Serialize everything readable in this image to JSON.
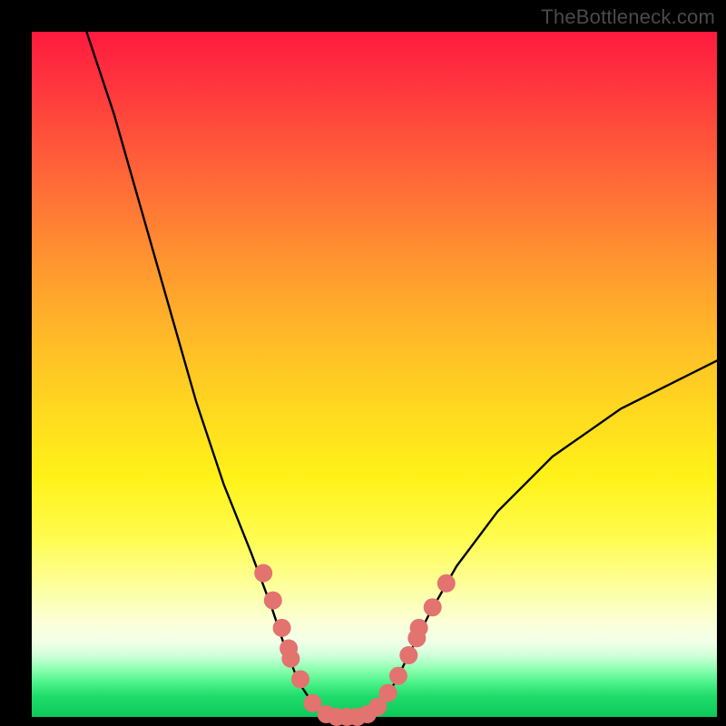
{
  "attribution": "TheBottleneck.com",
  "chart_data": {
    "type": "line",
    "title": "",
    "xlabel": "",
    "ylabel": "",
    "xlim": [
      0,
      100
    ],
    "ylim": [
      0,
      100
    ],
    "curve": [
      {
        "x": 8,
        "y": 100
      },
      {
        "x": 12,
        "y": 88
      },
      {
        "x": 16,
        "y": 74
      },
      {
        "x": 20,
        "y": 60
      },
      {
        "x": 24,
        "y": 46
      },
      {
        "x": 28,
        "y": 34
      },
      {
        "x": 32,
        "y": 24
      },
      {
        "x": 35,
        "y": 16
      },
      {
        "x": 37,
        "y": 10
      },
      {
        "x": 39,
        "y": 5
      },
      {
        "x": 41,
        "y": 2
      },
      {
        "x": 43,
        "y": 0.4
      },
      {
        "x": 45,
        "y": 0
      },
      {
        "x": 47,
        "y": 0
      },
      {
        "x": 49,
        "y": 0.4
      },
      {
        "x": 51,
        "y": 2
      },
      {
        "x": 53,
        "y": 5
      },
      {
        "x": 55,
        "y": 9
      },
      {
        "x": 58,
        "y": 15
      },
      {
        "x": 62,
        "y": 22
      },
      {
        "x": 68,
        "y": 30
      },
      {
        "x": 76,
        "y": 38
      },
      {
        "x": 86,
        "y": 45
      },
      {
        "x": 100,
        "y": 52
      }
    ],
    "scatter": [
      {
        "x": 33.8,
        "y": 21.0
      },
      {
        "x": 35.2,
        "y": 17.0
      },
      {
        "x": 36.5,
        "y": 13.0
      },
      {
        "x": 37.5,
        "y": 10.0
      },
      {
        "x": 37.8,
        "y": 8.5
      },
      {
        "x": 39.2,
        "y": 5.5
      },
      {
        "x": 41.0,
        "y": 2.0
      },
      {
        "x": 43.0,
        "y": 0.4
      },
      {
        "x": 44.5,
        "y": 0.0
      },
      {
        "x": 46.0,
        "y": 0.0
      },
      {
        "x": 47.5,
        "y": 0.0
      },
      {
        "x": 49.0,
        "y": 0.4
      },
      {
        "x": 50.5,
        "y": 1.5
      },
      {
        "x": 52.0,
        "y": 3.5
      },
      {
        "x": 53.5,
        "y": 6.0
      },
      {
        "x": 55.0,
        "y": 9.0
      },
      {
        "x": 56.2,
        "y": 11.5
      },
      {
        "x": 56.5,
        "y": 13.0
      },
      {
        "x": 58.5,
        "y": 16.0
      },
      {
        "x": 60.5,
        "y": 19.5
      }
    ]
  }
}
